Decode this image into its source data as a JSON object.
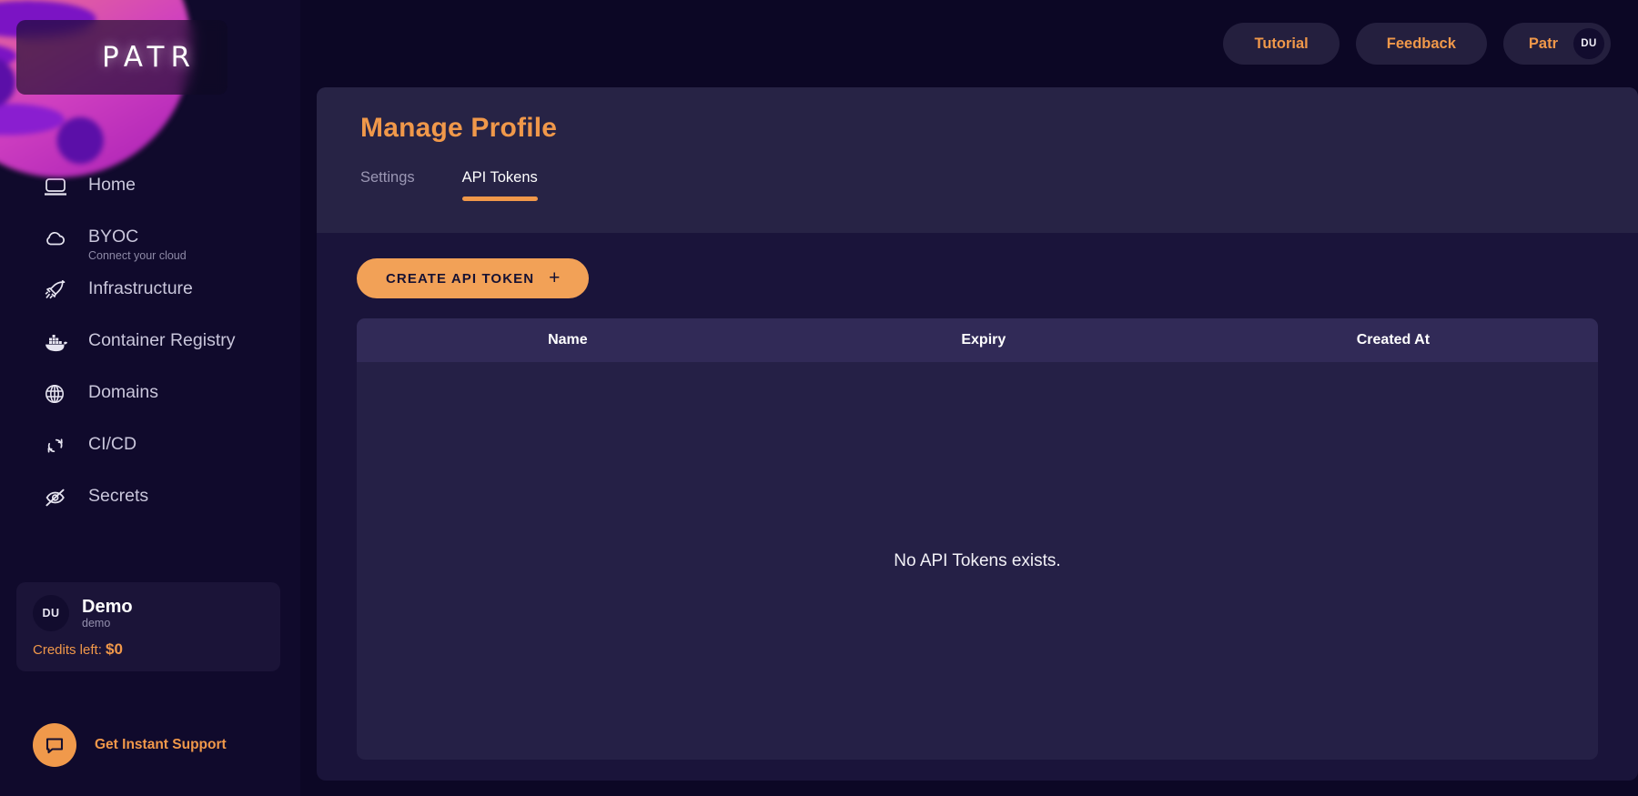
{
  "brand": {
    "logo_text": "PATR"
  },
  "sidebar": {
    "items": [
      {
        "label": "Home",
        "icon": "monitor-icon",
        "sub": null
      },
      {
        "label": "BYOC",
        "icon": "cloud-icon",
        "sub": "Connect your cloud"
      },
      {
        "label": "Infrastructure",
        "icon": "rocket-icon",
        "sub": null
      },
      {
        "label": "Container Registry",
        "icon": "docker-whale-icon",
        "sub": null
      },
      {
        "label": "Domains",
        "icon": "globe-icon",
        "sub": null
      },
      {
        "label": "CI/CD",
        "icon": "refresh-cycle-icon",
        "sub": null
      },
      {
        "label": "Secrets",
        "icon": "eye-off-icon",
        "sub": null
      }
    ],
    "workspace": {
      "avatar_initials": "DU",
      "name": "Demo",
      "subtitle": "demo",
      "credits_label": "Credits left:",
      "credits_value": "$0"
    },
    "support": {
      "label": "Get Instant Support",
      "icon": "chat-bubble-icon"
    }
  },
  "topbar": {
    "tutorial_label": "Tutorial",
    "feedback_label": "Feedback",
    "user_label": "Patr",
    "user_initials": "DU"
  },
  "page": {
    "title": "Manage Profile",
    "tabs": [
      {
        "label": "Settings",
        "active": false
      },
      {
        "label": "API Tokens",
        "active": true
      }
    ]
  },
  "api_tokens": {
    "create_button_label": "CREATE API TOKEN",
    "create_button_icon": "plus-icon",
    "columns": [
      "Name",
      "Expiry",
      "Created At"
    ],
    "rows": [],
    "empty_message": "No API Tokens exists."
  },
  "colors": {
    "accent": "#f0984a",
    "page_bg": "#0c0725",
    "sidebar_bg": "#100a2c",
    "panel_bg": "#1a143a",
    "panel_head_bg": "#272345",
    "table_bg": "#252046",
    "table_head_bg": "#312a57"
  }
}
